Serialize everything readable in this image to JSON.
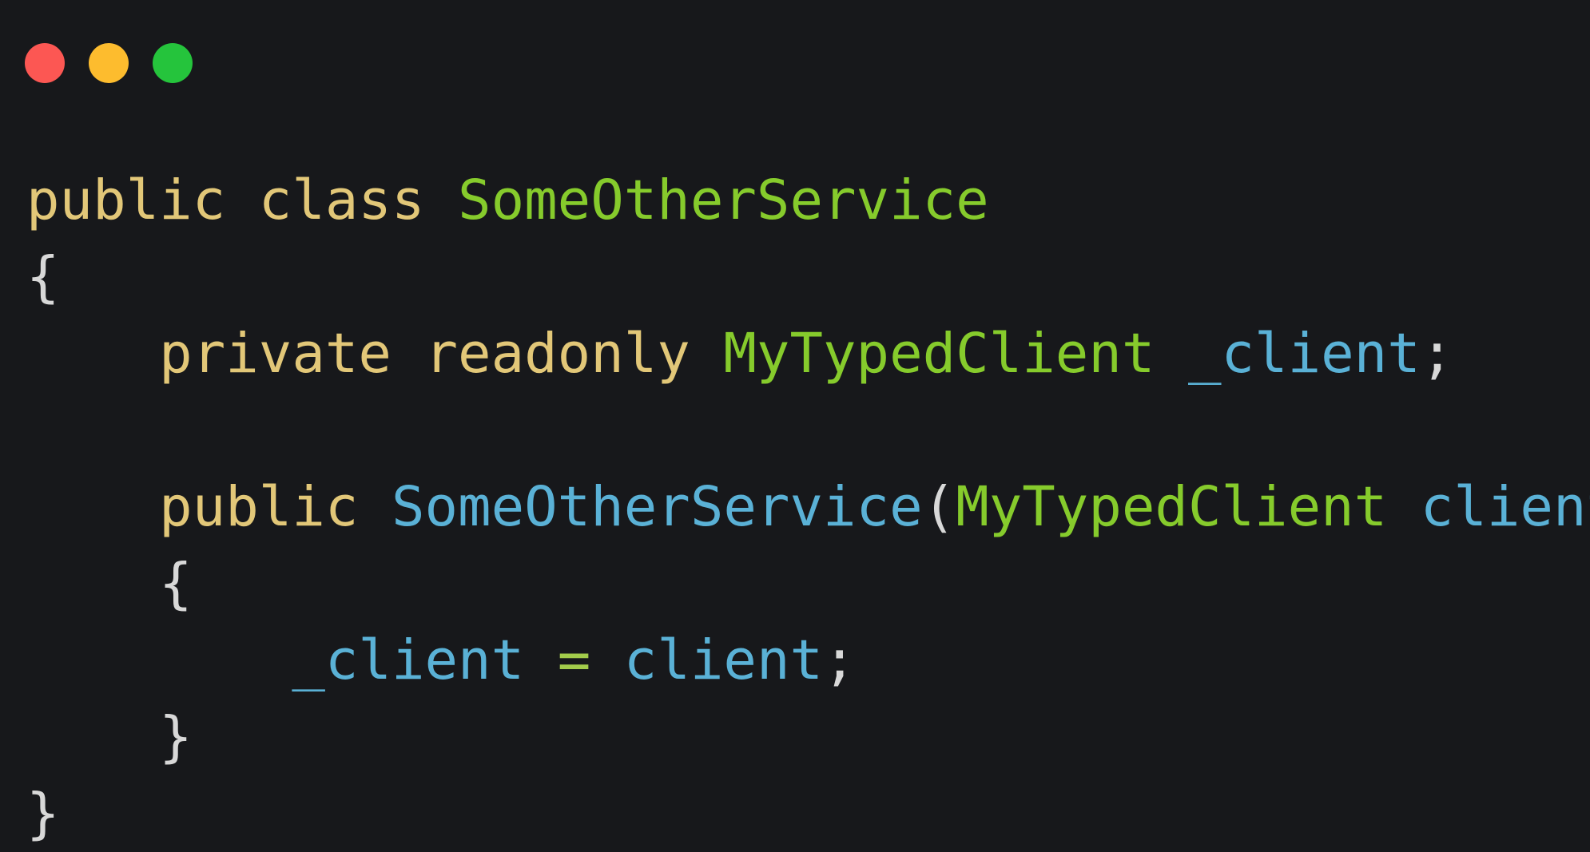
{
  "window": {
    "buttons": [
      {
        "name": "close",
        "color": "#fc5753"
      },
      {
        "name": "minimize",
        "color": "#fdbc2e"
      },
      {
        "name": "maximize",
        "color": "#25c43c"
      }
    ]
  },
  "theme": {
    "background": "#17181b",
    "keyword": "#e2c778",
    "type": "#86cb2c",
    "identifier": "#5ab1d6",
    "punctuation": "#d8d8d8",
    "operator": "#a3cc4b"
  },
  "code": {
    "language": "csharp",
    "lines": [
      [
        {
          "text": "public class ",
          "kind": "keyword"
        },
        {
          "text": "SomeOtherService",
          "kind": "type"
        }
      ],
      [
        {
          "text": "{",
          "kind": "punctuation"
        }
      ],
      [
        {
          "text": "    private readonly ",
          "kind": "keyword"
        },
        {
          "text": "MyTypedClient",
          "kind": "type"
        },
        {
          "text": " ",
          "kind": "punctuation"
        },
        {
          "text": "_client",
          "kind": "identifier"
        },
        {
          "text": ";",
          "kind": "punctuation"
        }
      ],
      [],
      [
        {
          "text": "    public ",
          "kind": "keyword"
        },
        {
          "text": "SomeOtherService",
          "kind": "identifier"
        },
        {
          "text": "(",
          "kind": "punctuation"
        },
        {
          "text": "MyTypedClient",
          "kind": "type"
        },
        {
          "text": " ",
          "kind": "punctuation"
        },
        {
          "text": "client",
          "kind": "identifier"
        },
        {
          "text": ")",
          "kind": "punctuation"
        }
      ],
      [
        {
          "text": "    {",
          "kind": "punctuation"
        }
      ],
      [
        {
          "text": "        ",
          "kind": "punctuation"
        },
        {
          "text": "_client",
          "kind": "identifier"
        },
        {
          "text": " ",
          "kind": "punctuation"
        },
        {
          "text": "=",
          "kind": "operator"
        },
        {
          "text": " ",
          "kind": "punctuation"
        },
        {
          "text": "client",
          "kind": "identifier"
        },
        {
          "text": ";",
          "kind": "punctuation"
        }
      ],
      [
        {
          "text": "    }",
          "kind": "punctuation"
        }
      ],
      [
        {
          "text": "}",
          "kind": "punctuation"
        }
      ]
    ]
  }
}
